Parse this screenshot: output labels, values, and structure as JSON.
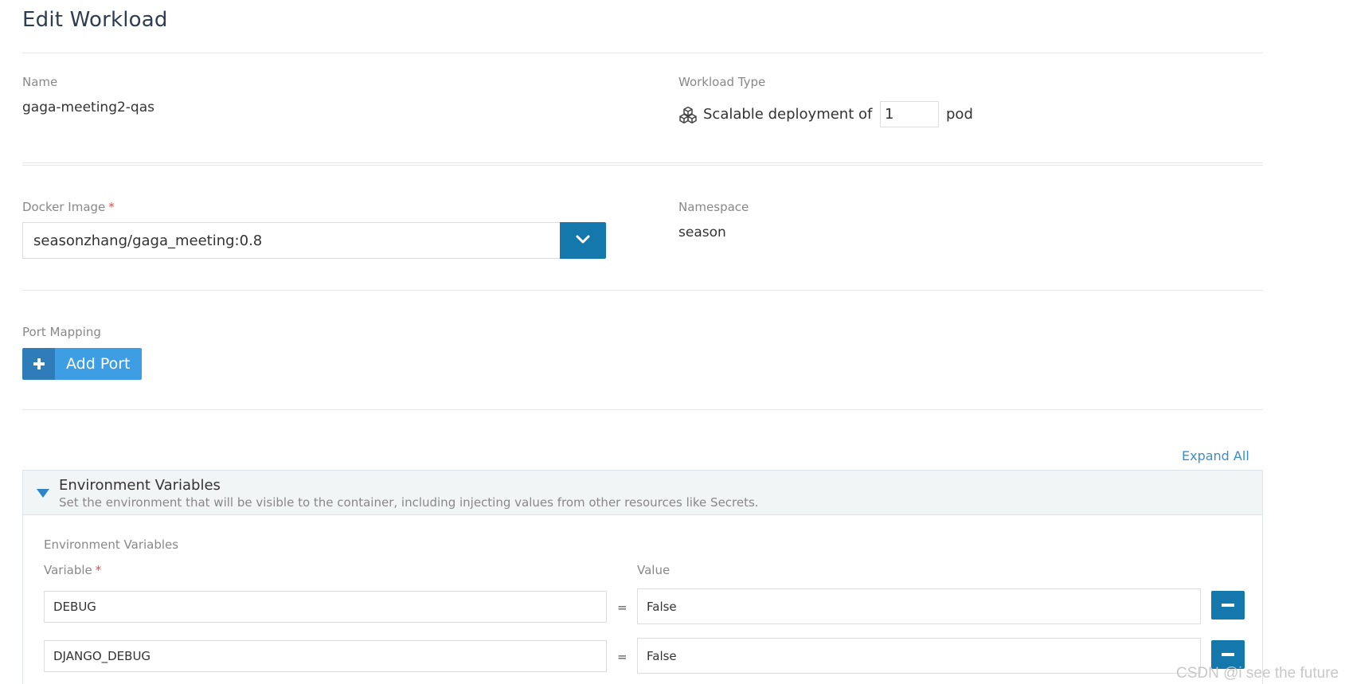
{
  "page": {
    "title": "Edit Workload"
  },
  "name": {
    "label": "Name",
    "value": "gaga-meeting2-qas"
  },
  "workload_type": {
    "label": "Workload Type",
    "icon": "cubes-icon",
    "prefix": "Scalable deployment of",
    "scale": "1",
    "suffix": "pod"
  },
  "docker_image": {
    "label": "Docker Image",
    "required_mark": "*",
    "value": "seasonzhang/gaga_meeting:0.8",
    "dropdown_icon": "chevron-down-icon"
  },
  "namespace": {
    "label": "Namespace",
    "value": "season"
  },
  "port_mapping": {
    "label": "Port Mapping",
    "add_label": "Add Port",
    "add_icon": "plus-icon"
  },
  "expand_all": "Expand All",
  "env_section": {
    "title": "Environment Variables",
    "description": "Set the environment that will be visible to the container, including injecting values from other resources like Secrets.",
    "subheading": "Environment Variables",
    "variable_label": "Variable",
    "required_mark": "*",
    "value_label": "Value",
    "equals": "=",
    "rows": [
      {
        "variable": "DEBUG",
        "value": "False"
      },
      {
        "variable": "DJANGO_DEBUG",
        "value": "False"
      }
    ],
    "accent_color": "#1578ad"
  },
  "watermark": "CSDN @i see the future"
}
